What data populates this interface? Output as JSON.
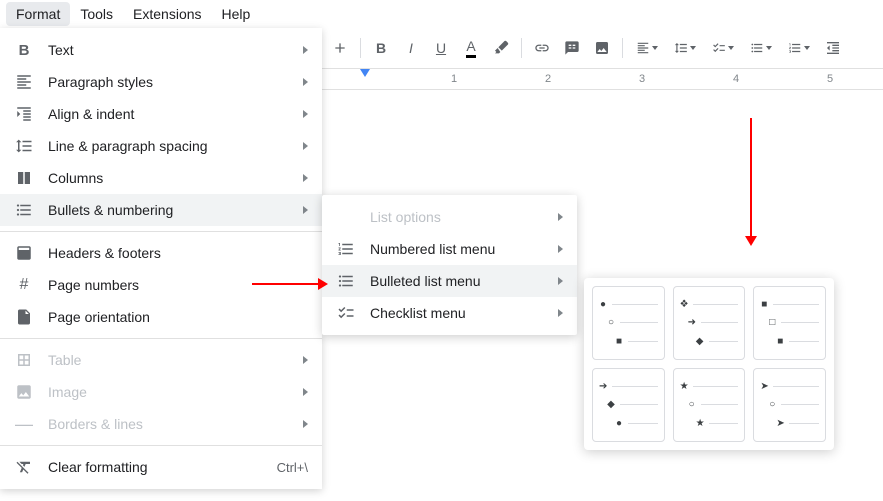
{
  "menubar": {
    "items": [
      "Format",
      "Tools",
      "Extensions",
      "Help"
    ],
    "active_index": 0
  },
  "format_menu": [
    {
      "label": "Text",
      "icon": "bold",
      "arrow": true
    },
    {
      "label": "Paragraph styles",
      "icon": "paragraph",
      "arrow": true
    },
    {
      "label": "Align & indent",
      "icon": "align",
      "arrow": true
    },
    {
      "label": "Line & paragraph spacing",
      "icon": "spacing",
      "arrow": true
    },
    {
      "label": "Columns",
      "icon": "columns",
      "arrow": true
    },
    {
      "label": "Bullets & numbering",
      "icon": "bullets",
      "arrow": true,
      "highlight": true
    },
    {
      "sep": true
    },
    {
      "label": "Headers & footers",
      "icon": "header"
    },
    {
      "label": "Page numbers",
      "icon": "hash"
    },
    {
      "label": "Page orientation",
      "icon": "orient"
    },
    {
      "sep": true
    },
    {
      "label": "Table",
      "icon": "table",
      "arrow": true,
      "disabled": true
    },
    {
      "label": "Image",
      "icon": "image",
      "arrow": true,
      "disabled": true
    },
    {
      "label": "Borders & lines",
      "icon": "borders",
      "arrow": true,
      "disabled": true
    },
    {
      "sep": true
    },
    {
      "label": "Clear formatting",
      "icon": "clear",
      "shortcut": "Ctrl+\\"
    }
  ],
  "submenu": [
    {
      "label": "List options",
      "icon": "",
      "arrow": true,
      "disabled": true
    },
    {
      "label": "Numbered list menu",
      "icon": "numbered",
      "arrow": true
    },
    {
      "label": "Bulleted list menu",
      "icon": "bulleted",
      "arrow": true,
      "highlight": true
    },
    {
      "label": "Checklist menu",
      "icon": "checklist",
      "arrow": true
    }
  ],
  "ruler": {
    "ticks": [
      "1",
      "2",
      "3",
      "4",
      "5"
    ]
  },
  "bullet_styles": [
    [
      "●",
      "○",
      "■"
    ],
    [
      "❖",
      "➜",
      "◆"
    ],
    [
      "■",
      "□",
      "■"
    ],
    [
      "➔",
      "◆",
      "●"
    ],
    [
      "★",
      "○",
      "★"
    ],
    [
      "➤",
      "○",
      "➤"
    ]
  ]
}
